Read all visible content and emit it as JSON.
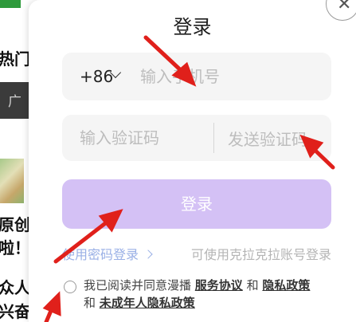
{
  "background": {
    "text_line1": "热门",
    "dark_band_text": "广",
    "text_line2": "原创",
    "text_line3": "啦！",
    "text_line4": "众人",
    "text_line5": "兴奋"
  },
  "modal": {
    "title": "登录",
    "phone": {
      "country_code": "+86",
      "placeholder": "输入手机号"
    },
    "code": {
      "placeholder": "输入验证码",
      "send_label": "发送验证码"
    },
    "login_label": "登录",
    "password_login_label": "使用密码登录",
    "kela_login_label": "可使用克拉克拉账号登录",
    "agreement": {
      "prefix": "我已阅读并同意漫播",
      "service_link": "服务协议",
      "and1": "和",
      "privacy_link": "隐私政策",
      "and2": "和",
      "minor_link": "未成年人隐私政策"
    }
  },
  "colors": {
    "login_button": "#d4c1f5",
    "link": "#9ab0e6",
    "annotation_arrow": "#e0201b"
  },
  "icons": {
    "close": "close-icon",
    "chevron": "chevron-down-icon",
    "chevron_right": "chevron-right-icon"
  }
}
